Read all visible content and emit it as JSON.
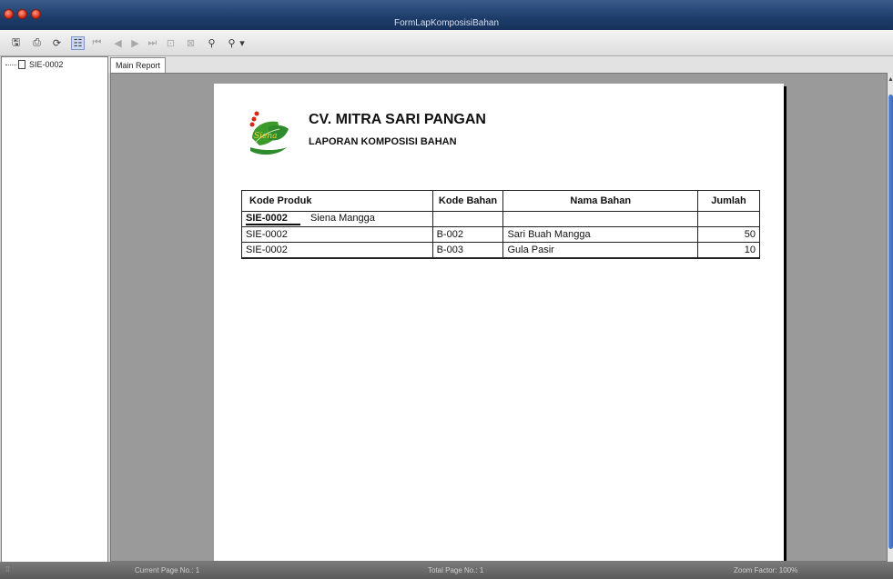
{
  "window": {
    "title": "FormLapKomposisiBahan"
  },
  "toolbar": {
    "buttons": [
      {
        "name": "export-icon",
        "glyph": "🖫",
        "disabled": false
      },
      {
        "name": "print-icon",
        "glyph": "⎙",
        "disabled": false
      },
      {
        "name": "refresh-icon",
        "glyph": "⟳",
        "disabled": false
      },
      {
        "name": "group-tree-icon",
        "glyph": "☷",
        "disabled": false
      },
      {
        "name": "first-page-icon",
        "glyph": "⏮",
        "disabled": true
      },
      {
        "name": "previous-page-icon",
        "glyph": "◀",
        "disabled": true
      },
      {
        "name": "next-page-icon",
        "glyph": "▶",
        "disabled": true
      },
      {
        "name": "last-page-icon",
        "glyph": "⏭",
        "disabled": true
      },
      {
        "name": "goto-page-icon",
        "glyph": "⊡",
        "disabled": true
      },
      {
        "name": "close-view-icon",
        "glyph": "⊠",
        "disabled": true
      },
      {
        "name": "find-icon",
        "glyph": "⚲",
        "disabled": false
      },
      {
        "name": "zoom-icon",
        "glyph": "⚲",
        "disabled": false
      },
      {
        "name": "zoom-dropdown-icon",
        "glyph": "▾",
        "disabled": false
      }
    ]
  },
  "tree": {
    "items": [
      {
        "label": "SIE-0002"
      }
    ]
  },
  "tabs": [
    {
      "label": "Main Report"
    }
  ],
  "report": {
    "company": "CV. MITRA SARI PANGAN",
    "title": "LAPORAN KOMPOSISI BAHAN",
    "logo_text": "Siena",
    "columns": [
      "Kode Produk",
      "Kode Bahan",
      "Nama Bahan",
      "Jumlah"
    ],
    "group": {
      "code": "SIE-0002",
      "name": "Siena Mangga"
    },
    "rows": [
      {
        "kode_produk": "SIE-0002",
        "kode_bahan": "B-002",
        "nama_bahan": "Sari Buah Mangga",
        "jumlah": "50"
      },
      {
        "kode_produk": "SIE-0002",
        "kode_bahan": "B-003",
        "nama_bahan": "Gula Pasir",
        "jumlah": "10"
      }
    ]
  },
  "status": {
    "current_page": "Current Page No.: 1",
    "total_page": "Total Page No.: 1",
    "zoom": "Zoom Factor: 100%"
  },
  "colors": {
    "titlebar": "#1d3c69",
    "viewer_bg": "#9a9a9a",
    "scroll_thumb": "#3e6bbd",
    "logo_green": "#2e8b2e"
  }
}
